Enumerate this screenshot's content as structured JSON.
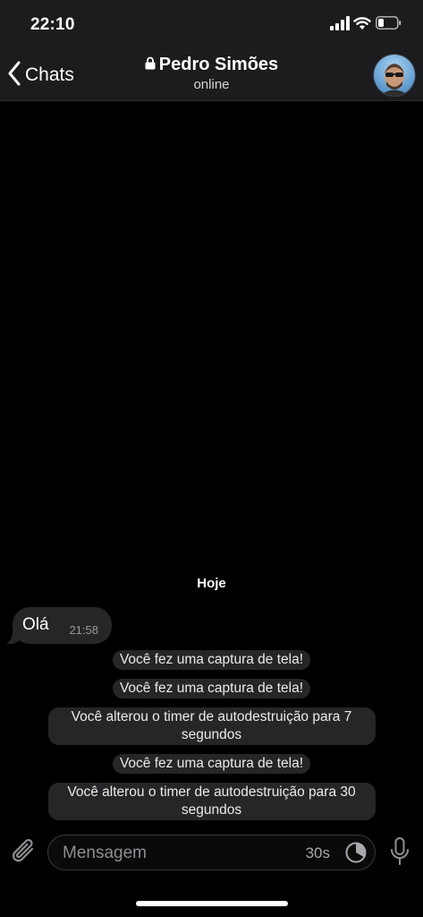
{
  "status_bar": {
    "time": "22:10",
    "icons": [
      "signal-icon",
      "wifi-icon",
      "battery-icon"
    ]
  },
  "nav": {
    "back_label": "Chats",
    "title": "Pedro Simões",
    "subtitle": "online",
    "icons": [
      "chevron-left-icon",
      "lock-icon"
    ]
  },
  "chat": {
    "date_header": "Hoje",
    "messages": [
      {
        "text": "Olá",
        "time": "21:58"
      }
    ],
    "service_messages": [
      "Você fez uma captura de tela!",
      "Você fez uma captura de tela!",
      "Você alterou o timer de autodestruição para 7 segundos",
      "Você fez uma captura de tela!",
      "Você alterou o timer de autodestruição para 30 segundos"
    ]
  },
  "composer": {
    "placeholder": "Mensagem",
    "timer_value": "30s",
    "icons": [
      "paperclip-icon",
      "timer-icon",
      "microphone-icon"
    ]
  },
  "colors": {
    "background": "#000000",
    "bar": "#1c1c1e",
    "bubble": "#262628",
    "secondary_text": "#8e8e93"
  }
}
